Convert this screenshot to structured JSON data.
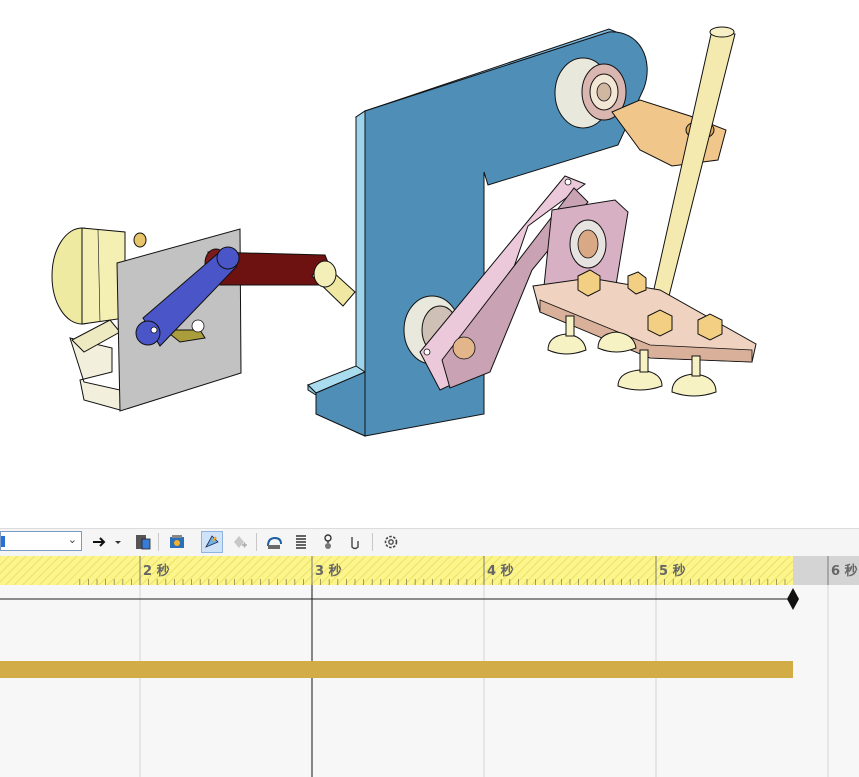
{
  "timeline": {
    "ticks": [
      {
        "label": "2 秒"
      },
      {
        "label": "3 秒"
      },
      {
        "label": "4 秒"
      },
      {
        "label": "5 秒"
      },
      {
        "label": "6 秒"
      }
    ]
  },
  "toolbar": {
    "icons": [
      "arrow-right-icon",
      "dropdown-chevron-icon",
      "save-animation-icon",
      "animation-wizard-icon",
      "auto-key-icon",
      "add-key-icon",
      "motor-icon",
      "spring-icon",
      "contact-icon",
      "gravity-icon",
      "settings-gear-icon"
    ]
  },
  "colors": {
    "ruler_yellow": "#fbf58c",
    "bar_gold": "#d2ac46",
    "bracket_blue": "#4f8eb7",
    "link_pink": "#c9a3b4",
    "crank_blue": "#4a55c8",
    "rod_maroon": "#6d1111"
  }
}
